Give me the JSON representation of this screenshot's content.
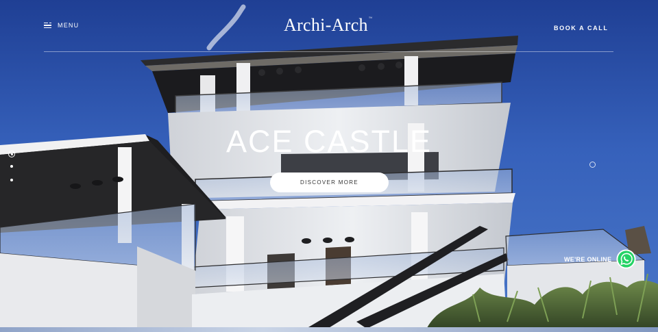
{
  "header": {
    "menu_label": "MENU",
    "logo_text": "Archi-Arch",
    "logo_tm": "™",
    "book_call_label": "BOOK A CALL"
  },
  "hero": {
    "title": "ACE CASTLE",
    "cta_label": "DISCOVER MORE",
    "slides": {
      "count": 3,
      "active": 1
    }
  },
  "whatsapp": {
    "label": "WE'RE ONLINE",
    "icon": "whatsapp-icon"
  },
  "icons": {
    "menu": "menu-icon",
    "slide_indicator": "circle-icon"
  },
  "colors": {
    "sky": "#3661bb",
    "whatsapp_green": "#25d366",
    "text": "#ffffff"
  }
}
